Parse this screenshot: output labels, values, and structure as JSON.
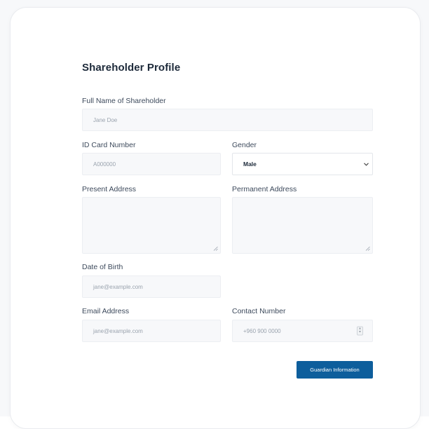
{
  "form": {
    "title": "Shareholder Profile",
    "full_name": {
      "label": "Full Name of Shareholder",
      "placeholder": "Jane Doe"
    },
    "id_card": {
      "label": "ID Card Number",
      "placeholder": "A000000"
    },
    "gender": {
      "label": "Gender",
      "value": "Male"
    },
    "present_address": {
      "label": "Present Address",
      "value": ""
    },
    "permanent_address": {
      "label": "Permanent Address",
      "value": ""
    },
    "dob": {
      "label": "Date of Birth",
      "placeholder": "jane@example.com"
    },
    "email": {
      "label": "Email Address",
      "placeholder": "jane@example.com"
    },
    "contact": {
      "label": "Contact Number",
      "placeholder": "+960 900 0000"
    },
    "submit_label": "Guardian Information"
  },
  "icons": {
    "select_chevron": "chevron-down-icon",
    "resize_grip": "resize-grip-icon",
    "spinner": "spinner-icon"
  },
  "colors": {
    "button": "#0d5e9c",
    "field_bg": "#f7f8fa",
    "title": "#1d2a3a"
  }
}
